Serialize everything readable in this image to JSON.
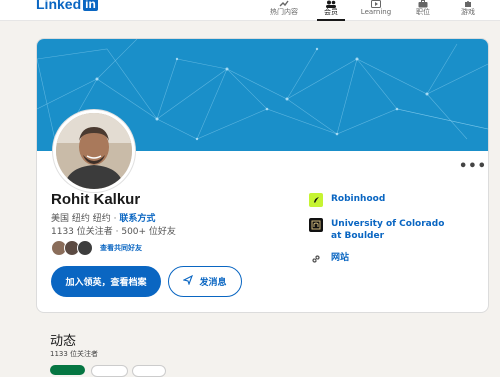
{
  "nav": {
    "logo": "Linked",
    "logo_in": "in",
    "items": [
      {
        "label": "热门内容"
      },
      {
        "label": "会员"
      },
      {
        "label": "Learning"
      },
      {
        "label": "职位"
      },
      {
        "label": "游戏"
      }
    ]
  },
  "profile": {
    "name": "Rohit Kalkur",
    "location": "美国 纽约 纽约",
    "separator": "·",
    "contact_link": "联系方式",
    "followers": "1133 位关注者 · 500+ 位好友",
    "mutual_link": "查看共同好友",
    "more_label": "•••",
    "primary_button": "加入领英，查看档案",
    "message_button": "发消息"
  },
  "sidebar": {
    "company": "Robinhood",
    "school": "University of Colorado at Boulder",
    "website": "网站"
  },
  "activity": {
    "title": "动态",
    "followers": "1133 位关注者"
  },
  "colors": {
    "brand": "#0a66c2",
    "banner": "#1a8fc9",
    "robinhood": "#c6f432"
  }
}
